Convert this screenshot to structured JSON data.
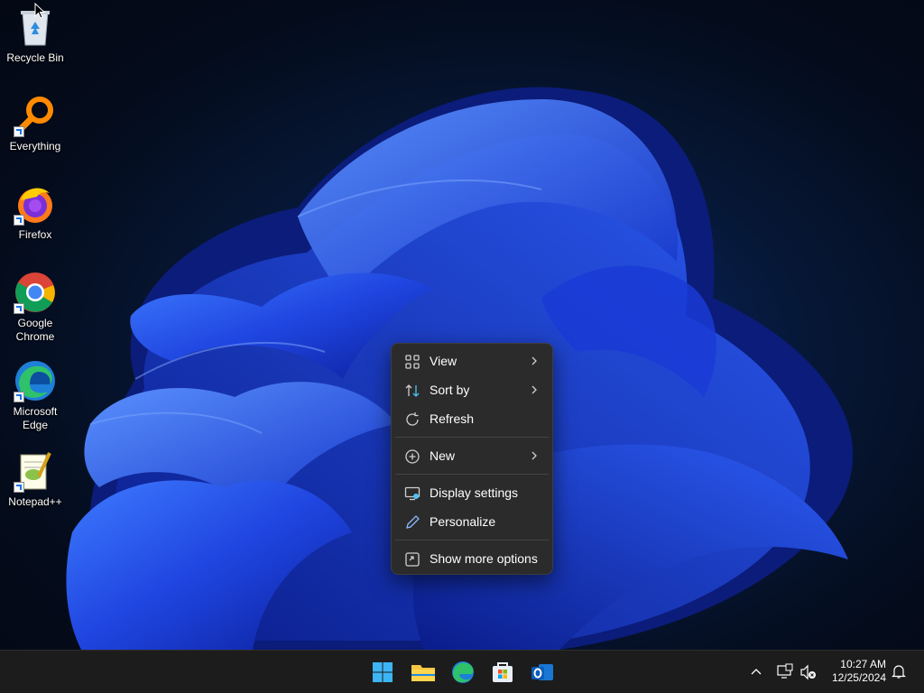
{
  "desktop": {
    "icons": [
      {
        "label": "Recycle Bin",
        "icon": "recycle-bin-icon"
      },
      {
        "label": "Everything",
        "icon": "everything-search-icon"
      },
      {
        "label": "Firefox",
        "icon": "firefox-icon"
      },
      {
        "label": "Google Chrome",
        "icon": "chrome-icon"
      },
      {
        "label": "Microsoft Edge",
        "icon": "edge-icon"
      },
      {
        "label": "Notepad++",
        "icon": "notepadpp-icon"
      }
    ]
  },
  "context_menu": {
    "items": [
      {
        "label": "View",
        "icon": "grid-view-icon",
        "submenu": true
      },
      {
        "label": "Sort by",
        "icon": "sort-icon",
        "submenu": true
      },
      {
        "label": "Refresh",
        "icon": "refresh-icon",
        "submenu": false
      },
      {
        "label": "New",
        "icon": "plus-circle-icon",
        "submenu": true
      },
      {
        "label": "Display settings",
        "icon": "display-settings-icon",
        "submenu": false
      },
      {
        "label": "Personalize",
        "icon": "pen-icon",
        "submenu": false
      },
      {
        "label": "Show more options",
        "icon": "show-more-icon",
        "submenu": false
      }
    ]
  },
  "taskbar": {
    "apps": [
      "start-icon",
      "file-explorer-icon",
      "edge-icon",
      "store-icon",
      "outlook-icon"
    ],
    "clock": {
      "time": "10:27 AM",
      "date": "12/25/2024"
    }
  },
  "colors": {
    "accent": "#2a5cff",
    "menu_bg": "#2b2b2b",
    "taskbar_bg": "#1c1c1c"
  }
}
